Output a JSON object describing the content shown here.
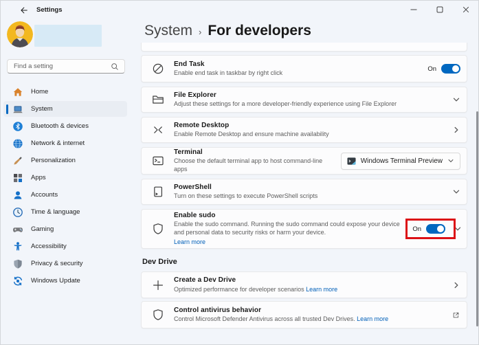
{
  "titlebar": {
    "title": "Settings"
  },
  "sidebar": {
    "search": {
      "placeholder": "Find a setting"
    },
    "items": [
      {
        "label": "Home"
      },
      {
        "label": "System",
        "selected": true
      },
      {
        "label": "Bluetooth & devices"
      },
      {
        "label": "Network & internet"
      },
      {
        "label": "Personalization"
      },
      {
        "label": "Apps"
      },
      {
        "label": "Accounts"
      },
      {
        "label": "Time & language"
      },
      {
        "label": "Gaming"
      },
      {
        "label": "Accessibility"
      },
      {
        "label": "Privacy & security"
      },
      {
        "label": "Windows Update"
      }
    ]
  },
  "header": {
    "breadcrumb": "System",
    "separator": "›",
    "title": "For developers"
  },
  "main": {
    "cards": [
      {
        "title": "End Task",
        "description": "Enable end task in taskbar by right click",
        "toggle": "On"
      },
      {
        "title": "File Explorer",
        "description": "Adjust these settings for a more developer-friendly experience using File Explorer"
      },
      {
        "title": "Remote Desktop",
        "description": "Enable Remote Desktop and ensure machine availability"
      },
      {
        "title": "Terminal",
        "description": "Choose the default terminal app to host command-line apps",
        "dropdown_value": "Windows Terminal Preview"
      },
      {
        "title": "PowerShell",
        "description": "Turn on these settings to execute PowerShell scripts"
      },
      {
        "title": "Enable sudo",
        "description": "Enable the sudo command. Running the sudo command could expose your device and personal data to security risks or harm your device.",
        "link": "Learn more",
        "toggle": "On"
      }
    ],
    "section_title": "Dev Drive",
    "dev_cards": [
      {
        "title": "Create a Dev Drive",
        "description": "Optimized performance for developer scenarios",
        "link": "Learn more"
      },
      {
        "title": "Control antivirus behavior",
        "description": "Control Microsoft Defender Antivirus across all trusted Dev Drives.",
        "link": "Learn more"
      }
    ]
  },
  "colors": {
    "accent": "#0067C0",
    "link": "#005FB8",
    "annotation_red": "#DC1016"
  }
}
